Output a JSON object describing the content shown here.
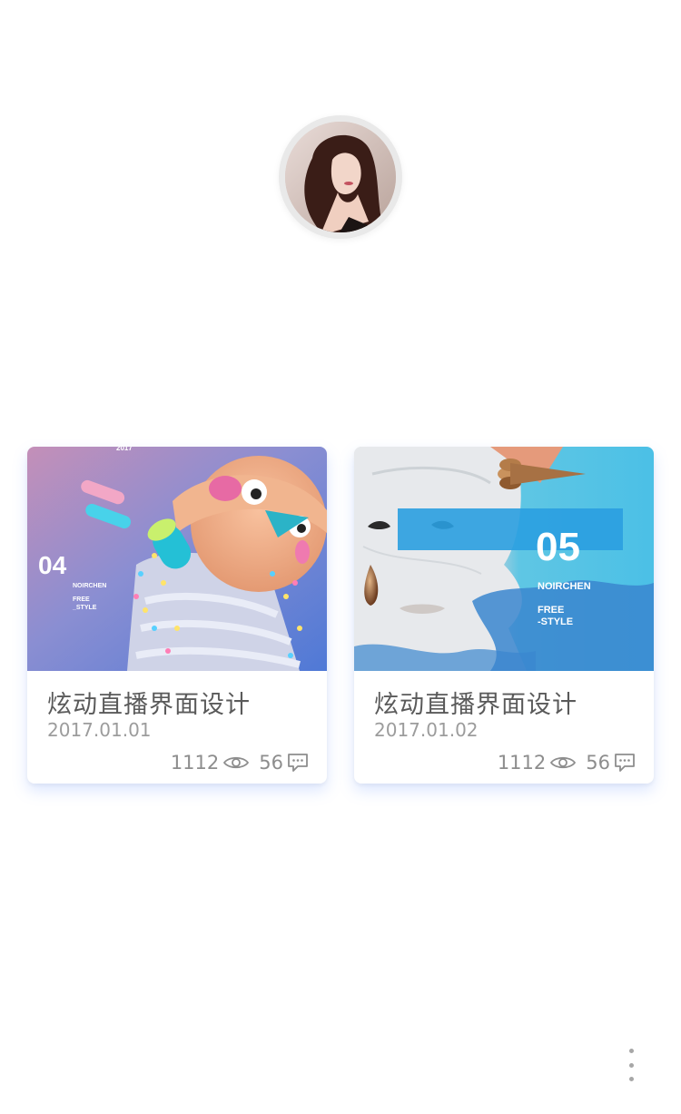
{
  "profile": {
    "avatar_alt": "avatar"
  },
  "cards": [
    {
      "title": "炫动直播界面设计",
      "date": "2017.01.01",
      "views": "1112",
      "comments": "56",
      "poster": {
        "number": "04",
        "brand": "NOIRCHEN",
        "tag1": "FREE",
        "tag2": "_STYLE",
        "year": "2017"
      }
    },
    {
      "title": "炫动直播界面设计",
      "date": "2017.01.02",
      "views": "1112",
      "comments": "56",
      "poster": {
        "number": "05",
        "brand": "NOIRCHEN",
        "tag1": "FREE",
        "tag2": "-STYLE"
      }
    }
  ],
  "colors": {
    "card_shadow": "#78a0ff",
    "title_text": "#5a5a5a",
    "meta_text": "#9c9c9c"
  },
  "icons": {
    "views": "eye-icon",
    "comments": "comment-icon",
    "more": "more-vertical-icon"
  }
}
